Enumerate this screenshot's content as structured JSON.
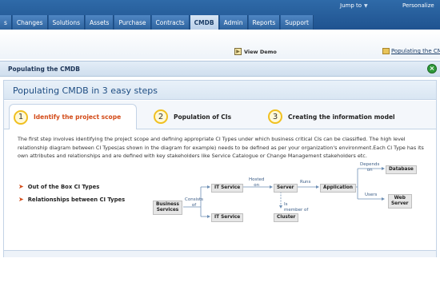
{
  "topbar": {
    "jump_to": "Jump to",
    "personalize": "Personalize",
    "tabs": [
      "s",
      "Changes",
      "Solutions",
      "Assets",
      "Purchase",
      "Contracts",
      "CMDB",
      "Admin",
      "Reports",
      "Support"
    ],
    "active_tab": "CMDB"
  },
  "toolbar": {
    "view_demo": "View Demo",
    "populating_link": "Populating the CMD"
  },
  "dialog": {
    "title": "Populating the CMDB",
    "panel_title": "Populating CMDB in 3 easy steps",
    "steps": [
      {
        "num": "1",
        "label": "Identify the project scope"
      },
      {
        "num": "2",
        "label": "Population of CIs"
      },
      {
        "num": "3",
        "label": "Creating the information model"
      }
    ],
    "description": "The first step involves identifying the project scope and defining appropriate CI Types under which business critical CIs can be classified. The high level relationship diagram between CI Types(as shown in the diagram for example) needs to be defined as per your organization's environment.Each CI Type has its own attributes and relationships and are defined with key stakeholders like Service Catalogue or Change Management stakeholders etc.",
    "bullets": [
      "Out of the Box CI Types",
      "Relationships between CI Types"
    ]
  },
  "diagram": {
    "nodes": {
      "business_services": "Business\nServices",
      "it_service_top": "IT Service",
      "it_service_bottom": "IT Service",
      "server": "Server",
      "application": "Application",
      "database": "Database",
      "web_server": "Web\nServer",
      "cluster": "Cluster"
    },
    "relations": {
      "consists_of": "Consists\nof",
      "hosted_on": "Hosted\non",
      "runs": "Runs",
      "is_member_of": "Is\nmember of",
      "depends_on": "Depends\non",
      "users": "Users"
    }
  },
  "colors": {
    "nav_blue": "#2f6aa8",
    "active_step": "#d34a17",
    "step_circle": "#f0c020",
    "close_green": "#2f9a3a"
  }
}
